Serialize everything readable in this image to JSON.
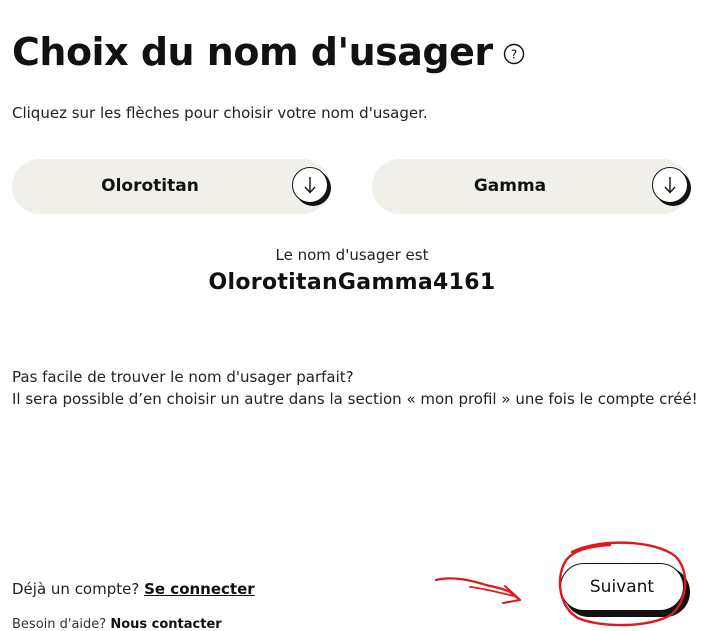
{
  "header": {
    "title": "Choix du nom d'usager",
    "help_icon": "question-circle-icon"
  },
  "instruction": "Cliquez sur les flèches pour choisir votre nom d'usager.",
  "selectors": [
    {
      "value": "Olorotitan",
      "icon": "arrow-down-icon"
    },
    {
      "value": "Gamma",
      "icon": "arrow-down-icon"
    }
  ],
  "result": {
    "caption": "Le nom d'usager est",
    "username": "OlorotitanGamma4161"
  },
  "hint": {
    "line1": "Pas facile de trouver le nom d'usager parfait?",
    "line2": "Il sera possible d’en choisir un autre dans la section « mon profil » une fois le compte créé!"
  },
  "footer": {
    "account_prompt": "Déjà un compte?",
    "login_link": "Se connecter",
    "help_prompt": "Besoin d'aide?",
    "contact_link": "Nous contacter",
    "next_label": "Suivant"
  },
  "colors": {
    "selector_bg": "#f1efe9",
    "text": "#111111",
    "annotation": "#e0181c"
  }
}
